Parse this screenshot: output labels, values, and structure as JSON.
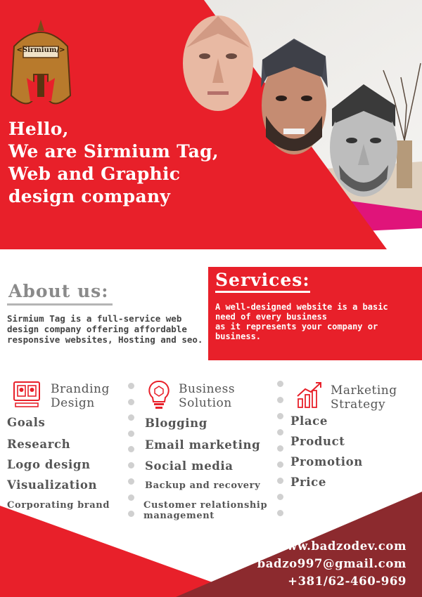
{
  "logo": {
    "text": "<Sirmium/>"
  },
  "hero": {
    "lines": [
      "Hello,",
      "We are Sirmium Tag,",
      "Web and Graphic",
      "design company"
    ]
  },
  "about": {
    "title": "About us:",
    "text": "Sirmium Tag is a full-service web design company offering affordable responsive websites, Hosting and seo."
  },
  "services": {
    "title": "Services:",
    "text_lines": [
      "A well-designed website is a basic",
      "need of every business",
      "as it represents your company or",
      "business."
    ]
  },
  "columns": [
    {
      "icon": "branding-design-icon",
      "heading": [
        "Branding",
        "Design"
      ],
      "items": [
        "Goals",
        "Research",
        "Logo design",
        "Visualization",
        "Corporating brand"
      ]
    },
    {
      "icon": "business-solution-icon",
      "heading": [
        "Business",
        "Solution"
      ],
      "items": [
        "Blogging",
        "Email marketing",
        "Social media",
        "Backup and recovery",
        "Customer relationship management"
      ]
    },
    {
      "icon": "marketing-strategy-icon",
      "heading": [
        "Marketing",
        "Strategy"
      ],
      "items": [
        "Place",
        "Product",
        "Promotion",
        "Price"
      ]
    }
  ],
  "contact": {
    "website": "www.badzodev.com",
    "email": "badzo997@gmail.com",
    "phone": "+381/62-460-969"
  },
  "colors": {
    "red": "#e8202a",
    "dark_red": "#8c2a2e",
    "magenta": "#e0147a",
    "grey_text": "#555555"
  }
}
